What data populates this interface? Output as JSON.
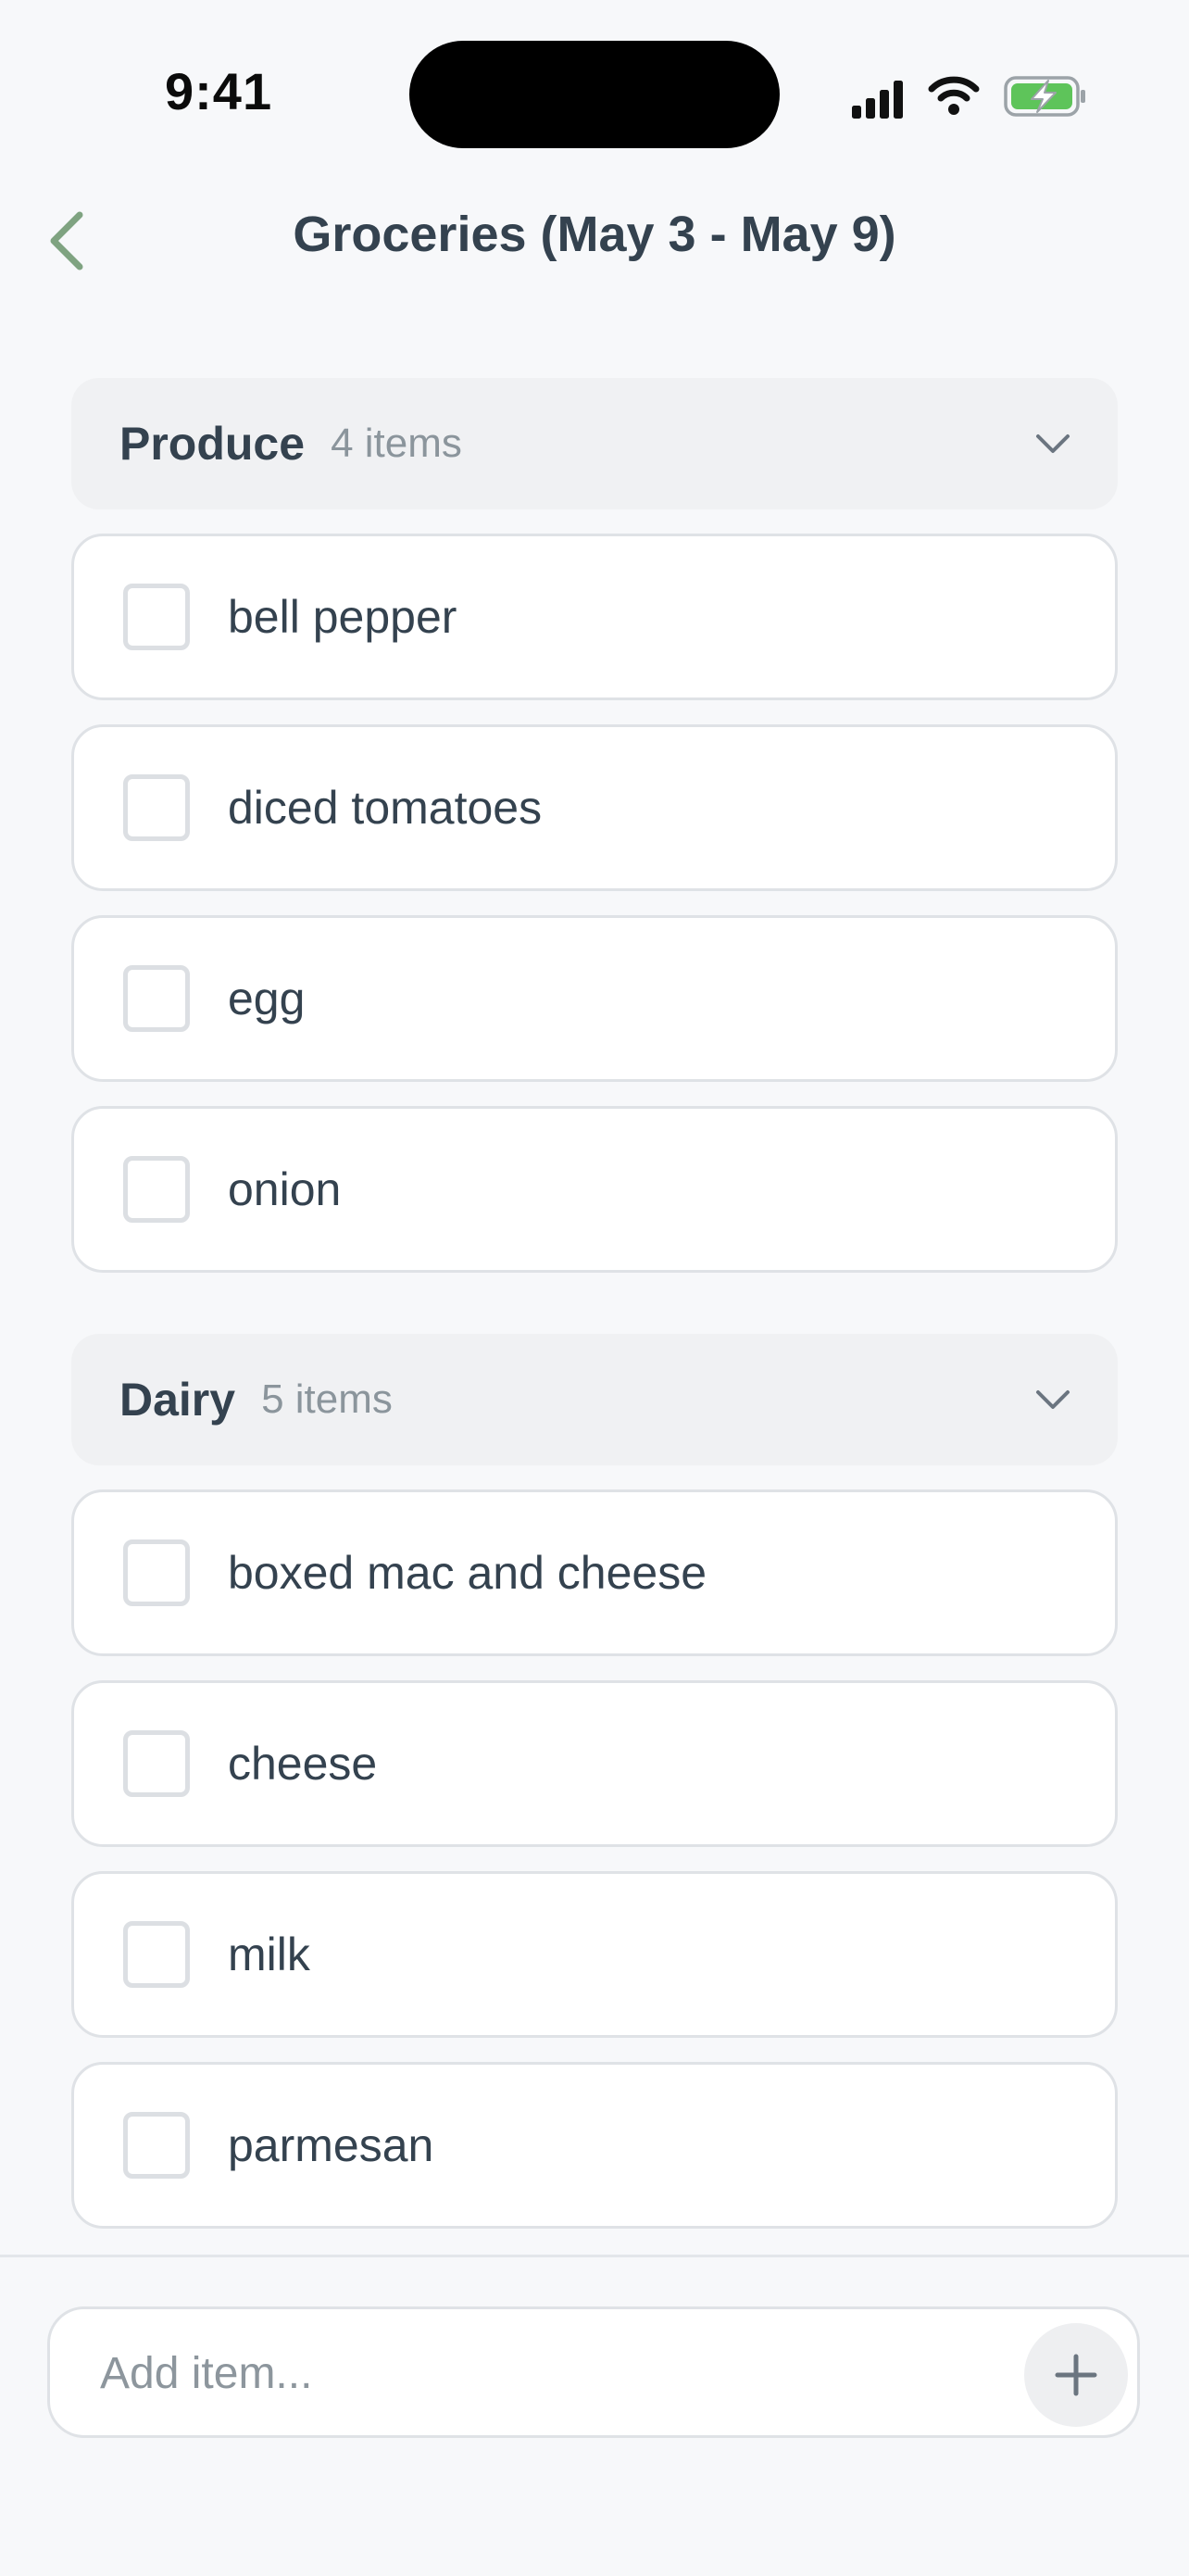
{
  "status_bar": {
    "time": "9:41"
  },
  "header": {
    "title": "Groceries (May 3 - May 9)",
    "back_icon": "chevron-left-icon"
  },
  "colors": {
    "accent": "#7fa381",
    "battery": "#5ec45a",
    "text": "#34424f",
    "muted": "#8b959c"
  },
  "sections": [
    {
      "name": "Produce",
      "count": "4 items",
      "items": [
        {
          "label": "bell pepper",
          "checked": false
        },
        {
          "label": "diced tomatoes",
          "checked": false
        },
        {
          "label": "egg",
          "checked": false
        },
        {
          "label": "onion",
          "checked": false
        }
      ]
    },
    {
      "name": "Dairy",
      "count": "5 items",
      "items": [
        {
          "label": "boxed mac and cheese",
          "checked": false
        },
        {
          "label": "cheese",
          "checked": false
        },
        {
          "label": "milk",
          "checked": false
        },
        {
          "label": "parmesan",
          "checked": false
        }
      ]
    }
  ],
  "add_bar": {
    "placeholder": "Add item...",
    "add_icon": "plus-icon"
  }
}
